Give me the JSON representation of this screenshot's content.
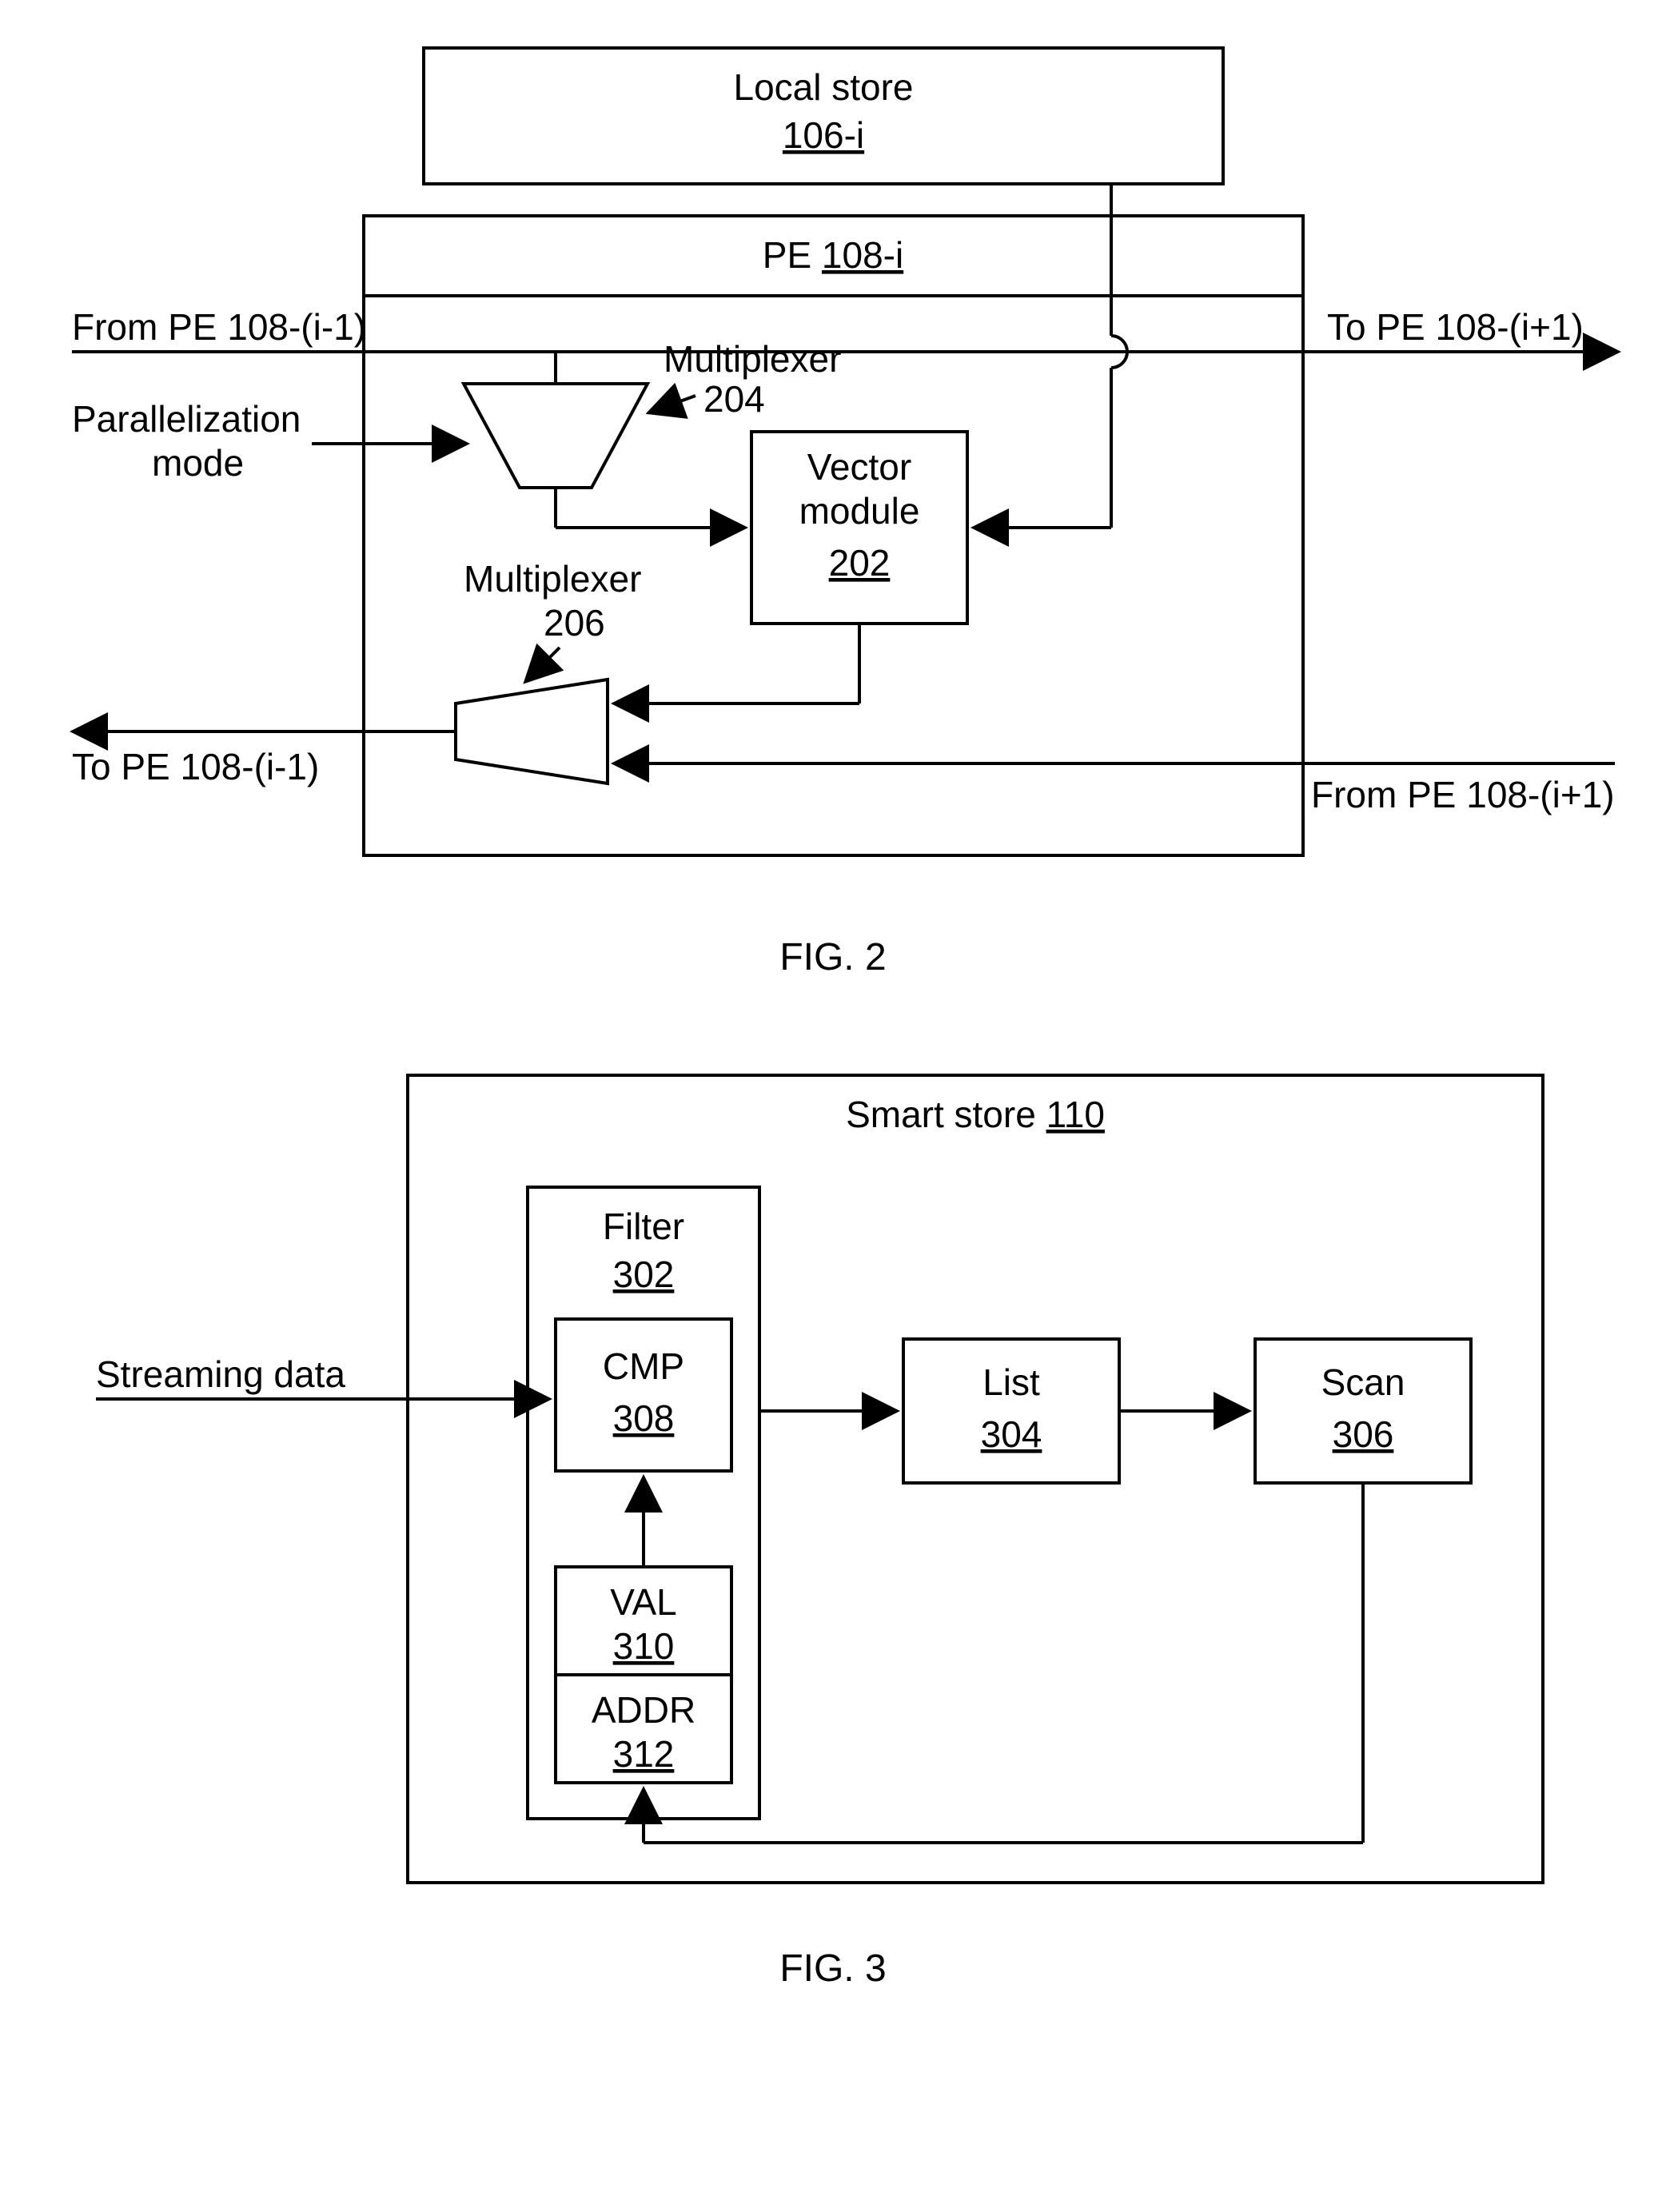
{
  "fig2": {
    "caption": "FIG. 2",
    "local_store": {
      "label": "Local store",
      "ref": "106-i"
    },
    "pe": {
      "label_prefix": "PE",
      "ref": "108-i"
    },
    "mux204": {
      "label": "Multiplexer",
      "ref": "204"
    },
    "mux206": {
      "label": "Multiplexer",
      "ref": "206"
    },
    "vector": {
      "label": "Vector",
      "label2": "module",
      "ref": "202"
    },
    "labels": {
      "from_prev": "From PE 108-(i-1)",
      "to_next": "To PE 108-(i+1)",
      "parallel": "Parallelization",
      "mode": "mode",
      "to_prev": "To PE 108-(i-1)",
      "from_next": "From PE 108-(i+1)"
    }
  },
  "fig3": {
    "caption": "FIG. 3",
    "smart_store": {
      "label_prefix": "Smart store",
      "ref": "110"
    },
    "filter": {
      "label": "Filter",
      "ref": "302"
    },
    "cmp": {
      "label": "CMP",
      "ref": "308"
    },
    "val": {
      "label": "VAL",
      "ref": "310"
    },
    "addr": {
      "label": "ADDR",
      "ref": "312"
    },
    "list": {
      "label": "List",
      "ref": "304"
    },
    "scan": {
      "label": "Scan",
      "ref": "306"
    },
    "labels": {
      "streaming": "Streaming data"
    }
  }
}
